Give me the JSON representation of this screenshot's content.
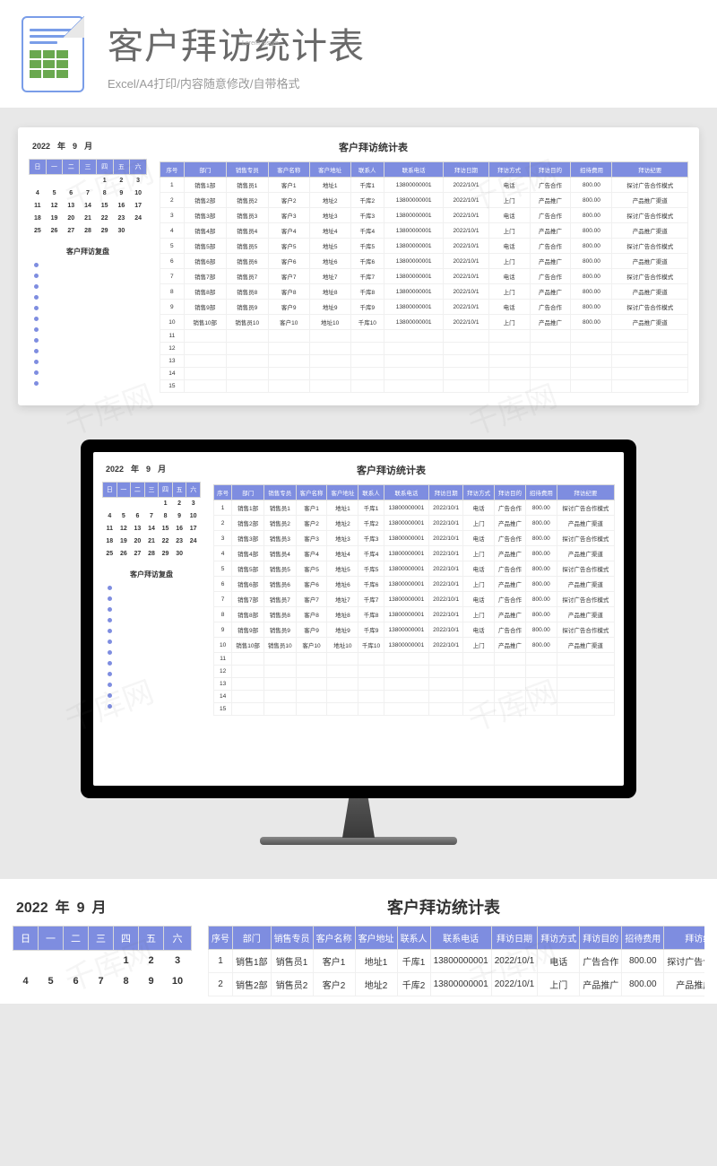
{
  "banner": {
    "title": "客户拜访统计表",
    "lorem": "Lorem Ipsum",
    "subtitle": "Excel/A4打印/内容随意修改/自带格式"
  },
  "date": {
    "year": "2022",
    "y_lbl": "年",
    "month": "9",
    "m_lbl": "月"
  },
  "mainTitle": "客户拜访统计表",
  "calendar": {
    "heads": [
      "日",
      "一",
      "二",
      "三",
      "四",
      "五",
      "六"
    ],
    "rows": [
      [
        "",
        "",
        "",
        "",
        "1",
        "2",
        "3"
      ],
      [
        "4",
        "5",
        "6",
        "7",
        "8",
        "9",
        "10"
      ],
      [
        "11",
        "12",
        "13",
        "14",
        "15",
        "16",
        "17"
      ],
      [
        "18",
        "19",
        "20",
        "21",
        "22",
        "23",
        "24"
      ],
      [
        "25",
        "26",
        "27",
        "28",
        "29",
        "30",
        ""
      ]
    ]
  },
  "reviewTitle": "客户拜访复盘",
  "table": {
    "cols": [
      "序号",
      "部门",
      "销售专员",
      "客户名称",
      "客户地址",
      "联系人",
      "联系电话",
      "拜访日期",
      "拜访方式",
      "拜访目的",
      "招待费用",
      "拜访纪要"
    ],
    "rows": [
      [
        "1",
        "销售1部",
        "销售员1",
        "客户1",
        "地址1",
        "千库1",
        "13800000001",
        "2022/10/1",
        "电话",
        "广告合作",
        "800.00",
        "探讨广告合作模式"
      ],
      [
        "2",
        "销售2部",
        "销售员2",
        "客户2",
        "地址2",
        "千库2",
        "13800000001",
        "2022/10/1",
        "上门",
        "产品推广",
        "800.00",
        "产品推广渠道"
      ],
      [
        "3",
        "销售3部",
        "销售员3",
        "客户3",
        "地址3",
        "千库3",
        "13800000001",
        "2022/10/1",
        "电话",
        "广告合作",
        "800.00",
        "探讨广告合作模式"
      ],
      [
        "4",
        "销售4部",
        "销售员4",
        "客户4",
        "地址4",
        "千库4",
        "13800000001",
        "2022/10/1",
        "上门",
        "产品推广",
        "800.00",
        "产品推广渠道"
      ],
      [
        "5",
        "销售5部",
        "销售员5",
        "客户5",
        "地址5",
        "千库5",
        "13800000001",
        "2022/10/1",
        "电话",
        "广告合作",
        "800.00",
        "探讨广告合作模式"
      ],
      [
        "6",
        "销售6部",
        "销售员6",
        "客户6",
        "地址6",
        "千库6",
        "13800000001",
        "2022/10/1",
        "上门",
        "产品推广",
        "800.00",
        "产品推广渠道"
      ],
      [
        "7",
        "销售7部",
        "销售员7",
        "客户7",
        "地址7",
        "千库7",
        "13800000001",
        "2022/10/1",
        "电话",
        "广告合作",
        "800.00",
        "探讨广告合作模式"
      ],
      [
        "8",
        "销售8部",
        "销售员8",
        "客户8",
        "地址8",
        "千库8",
        "13800000001",
        "2022/10/1",
        "上门",
        "产品推广",
        "800.00",
        "产品推广渠道"
      ],
      [
        "9",
        "销售9部",
        "销售员9",
        "客户9",
        "地址9",
        "千库9",
        "13800000001",
        "2022/10/1",
        "电话",
        "广告合作",
        "800.00",
        "探讨广告合作模式"
      ],
      [
        "10",
        "销售10部",
        "销售员10",
        "客户10",
        "地址10",
        "千库10",
        "13800000001",
        "2022/10/1",
        "上门",
        "产品推广",
        "800.00",
        "产品推广渠道"
      ],
      [
        "11",
        "",
        "",
        "",
        "",
        "",
        "",
        "",
        "",
        "",
        "",
        ""
      ],
      [
        "12",
        "",
        "",
        "",
        "",
        "",
        "",
        "",
        "",
        "",
        "",
        ""
      ],
      [
        "13",
        "",
        "",
        "",
        "",
        "",
        "",
        "",
        "",
        "",
        "",
        ""
      ],
      [
        "14",
        "",
        "",
        "",
        "",
        "",
        "",
        "",
        "",
        "",
        "",
        ""
      ],
      [
        "15",
        "",
        "",
        "",
        "",
        "",
        "",
        "",
        "",
        "",
        "",
        ""
      ]
    ]
  },
  "colors": {
    "accent": "#7e8de0",
    "green": "#6aa84f"
  },
  "watermark": "千库网"
}
